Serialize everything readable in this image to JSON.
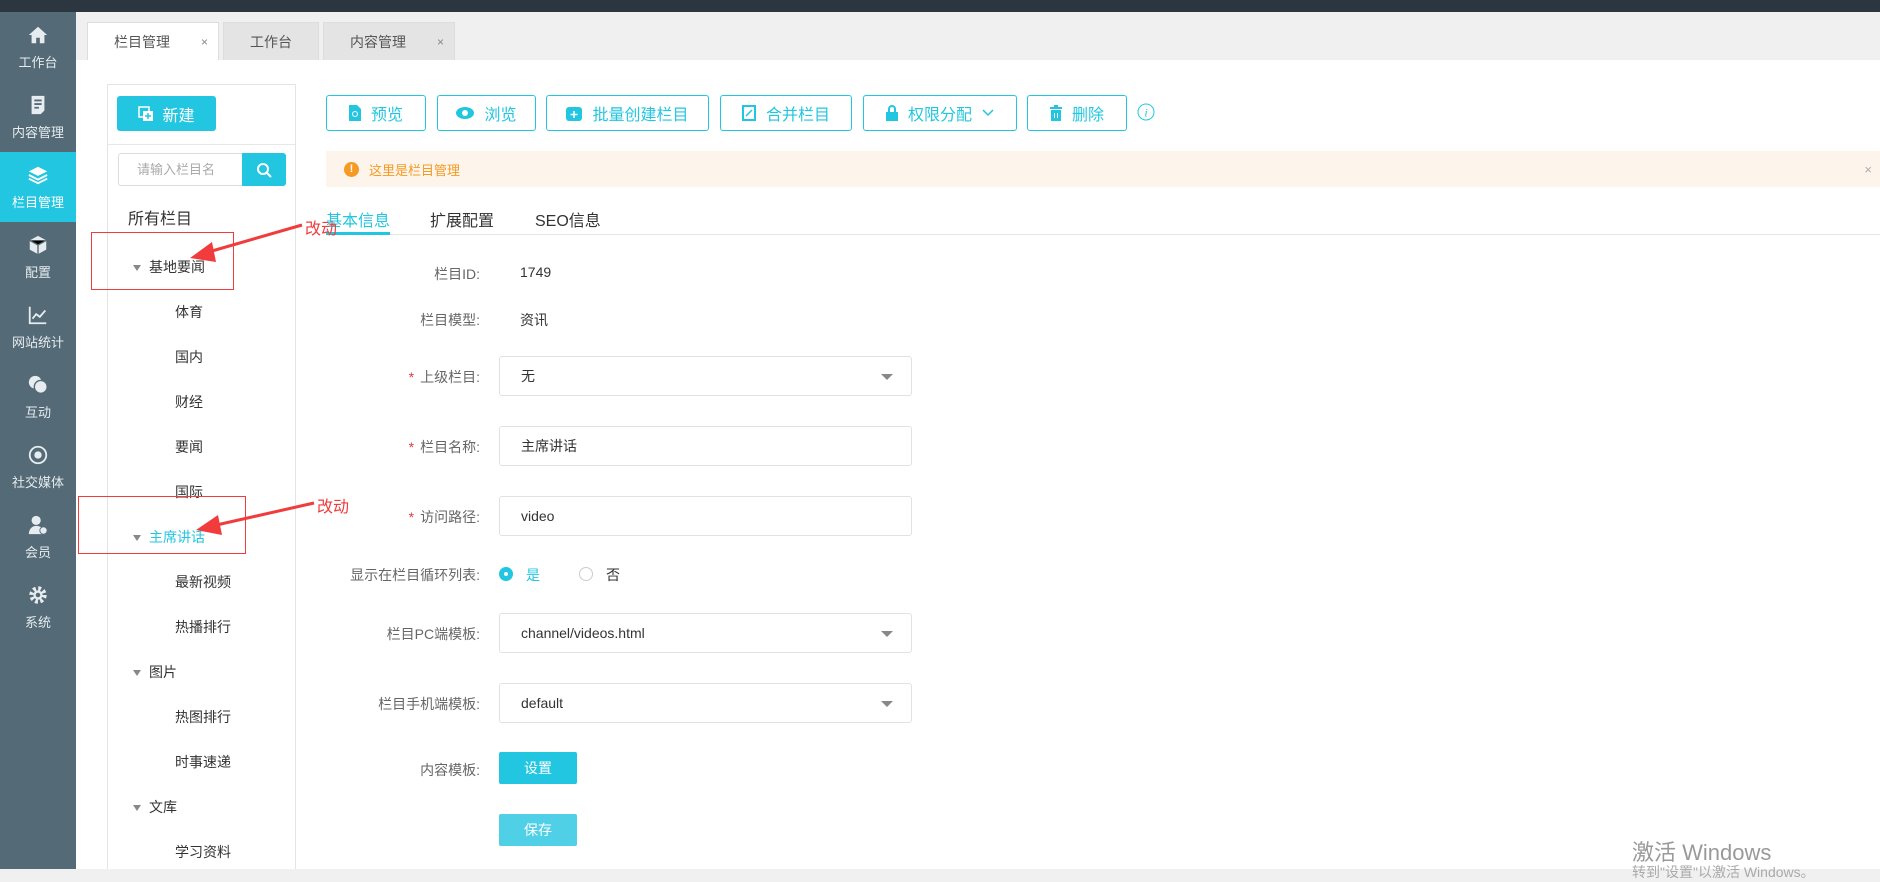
{
  "sidebar": {
    "items": [
      {
        "label": "工作台",
        "icon": "home-icon"
      },
      {
        "label": "内容管理",
        "icon": "document-icon"
      },
      {
        "label": "栏目管理",
        "icon": "layers-icon",
        "active": true
      },
      {
        "label": "配置",
        "icon": "cube-icon"
      },
      {
        "label": "网站统计",
        "icon": "chart-icon"
      },
      {
        "label": "互动",
        "icon": "chat-icon"
      },
      {
        "label": "社交媒体",
        "icon": "target-icon"
      },
      {
        "label": "会员",
        "icon": "user-icon"
      },
      {
        "label": "系统",
        "icon": "gear-icon"
      }
    ]
  },
  "tabs": [
    {
      "label": "栏目管理",
      "close": "×"
    },
    {
      "label": "工作台"
    },
    {
      "label": "内容管理",
      "close": "×"
    }
  ],
  "left": {
    "new_label": "新建",
    "search_placeholder": "请输入栏目名",
    "tree_title": "所有栏目",
    "tree": [
      {
        "label": "基地要闻",
        "level": 0
      },
      {
        "label": "体育",
        "level": 1
      },
      {
        "label": "国内",
        "level": 1
      },
      {
        "label": "财经",
        "level": 1
      },
      {
        "label": "要闻",
        "level": 1
      },
      {
        "label": "国际",
        "level": 1
      },
      {
        "label": "主席讲话",
        "level": 0,
        "selected": true
      },
      {
        "label": "最新视频",
        "level": 1
      },
      {
        "label": "热播排行",
        "level": 1
      },
      {
        "label": "图片",
        "level": 0
      },
      {
        "label": "热图排行",
        "level": 1
      },
      {
        "label": "时事速递",
        "level": 1
      },
      {
        "label": "文库",
        "level": 0
      },
      {
        "label": "学习资料",
        "level": 1
      }
    ]
  },
  "toolbar": {
    "preview": "预览",
    "browse": "浏览",
    "batch_create": "批量创建栏目",
    "merge": "合并栏目",
    "permission": "权限分配",
    "delete": "删除"
  },
  "alert": {
    "text": "这里是栏目管理",
    "close": "×"
  },
  "form_tabs": [
    "基本信息",
    "扩展配置",
    "SEO信息"
  ],
  "form": {
    "id_label": "栏目ID:",
    "id_value": "1749",
    "model_label": "栏目模型:",
    "model_value": "资讯",
    "parent_label": "上级栏目:",
    "parent_value": "无",
    "name_label": "栏目名称:",
    "name_value": "主席讲话",
    "path_label": "访问路径:",
    "path_value": "video",
    "show_label": "显示在栏目循环列表:",
    "show_yes": "是",
    "show_no": "否",
    "pc_label": "栏目PC端模板:",
    "pc_value": "channel/videos.html",
    "mobile_label": "栏目手机端模板:",
    "mobile_value": "default",
    "content_label": "内容模板:",
    "content_button": "设置",
    "save_button": "保存",
    "required_mark": "*"
  },
  "annotations": {
    "note1": "改动",
    "note2": "改动"
  },
  "watermark": {
    "line1": "激活 Windows",
    "line2": "转到\"设置\"以激活 Windows。"
  },
  "colors": {
    "accent": "#23c6e0",
    "sidebar": "#546a76",
    "warning": "#f59a23",
    "annotation": "#f03c3c"
  }
}
